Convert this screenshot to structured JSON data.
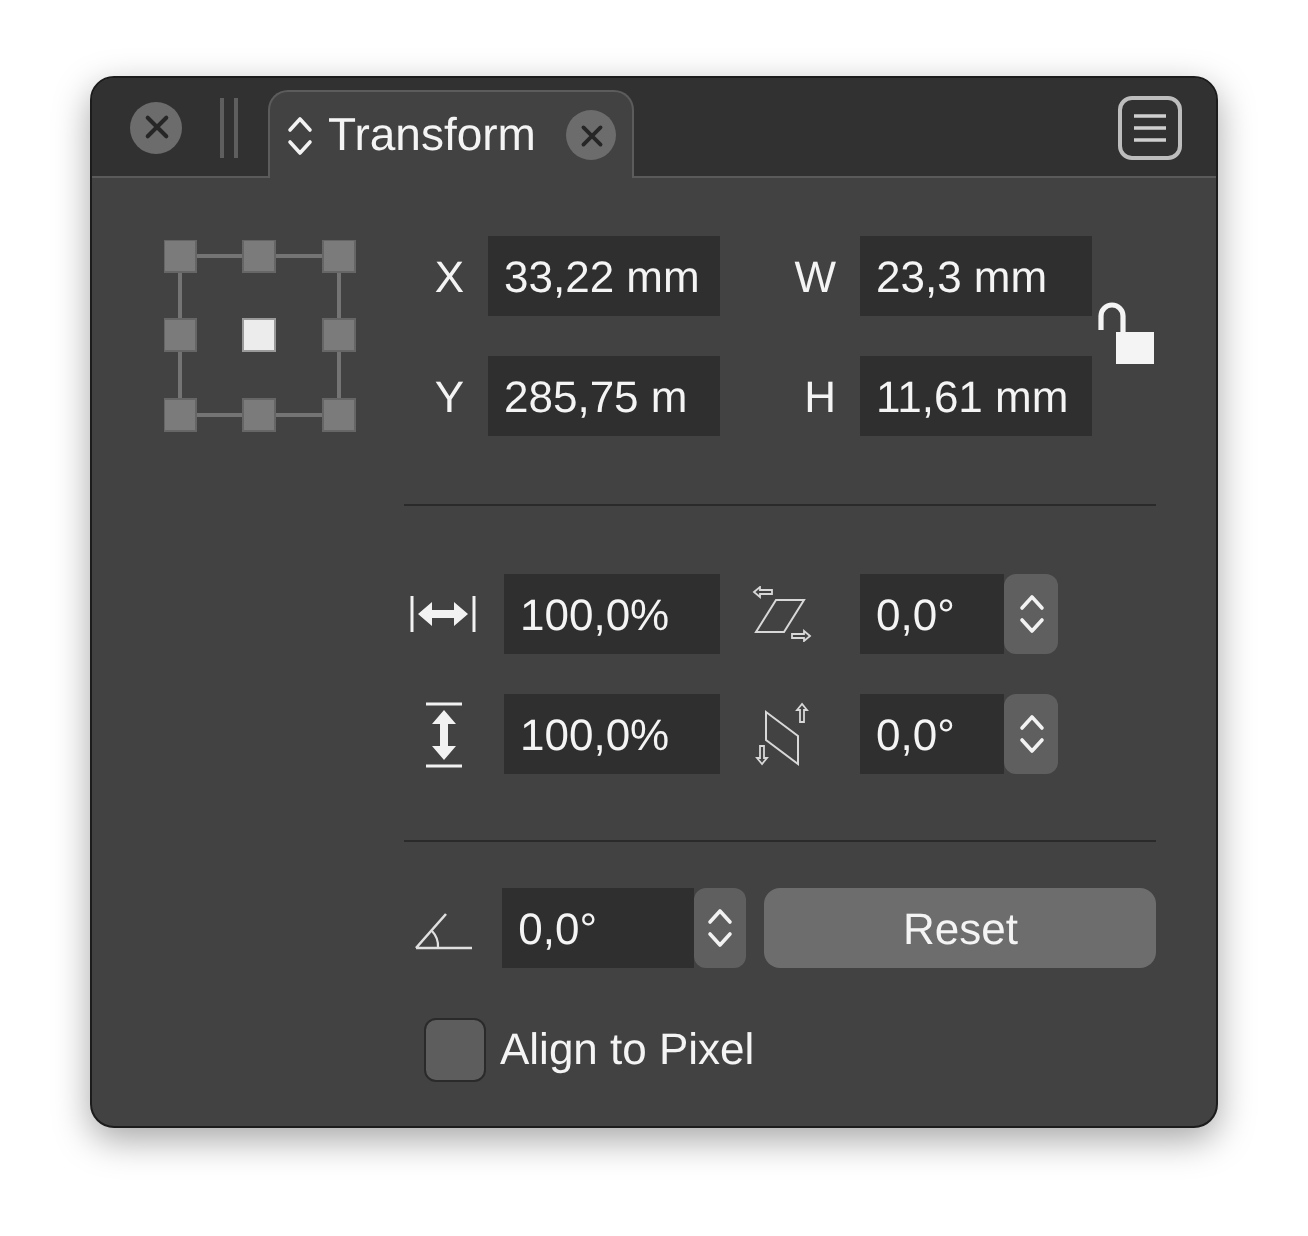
{
  "panel": {
    "tabs": [
      {
        "label": "Transform",
        "selected": true
      }
    ]
  },
  "anchor_points": [
    {
      "selected": false
    },
    {
      "selected": false
    },
    {
      "selected": false
    },
    {
      "selected": false
    },
    {
      "selected": true
    },
    {
      "selected": false
    },
    {
      "selected": false
    },
    {
      "selected": false
    },
    {
      "selected": false
    }
  ],
  "position_fields": [
    {
      "label": "X",
      "value": "33,22 mm"
    },
    {
      "label": "W",
      "value": "23,3 mm"
    },
    {
      "label": "Y",
      "value": "285,75 m"
    },
    {
      "label": "H",
      "value": "11,61 mm"
    }
  ],
  "aspect_lock": {
    "locked": false
  },
  "scale_fields": [
    {
      "kind": "width",
      "value": "100,0%"
    },
    {
      "kind": "height",
      "value": "100,0%"
    }
  ],
  "shear_fields": [
    {
      "kind": "horizontal",
      "value": "0,0°"
    },
    {
      "kind": "vertical",
      "value": "0,0°"
    }
  ],
  "rotation": {
    "value": "0,0°"
  },
  "reset_button": {
    "label": "Reset"
  },
  "align_to_pixels": {
    "label": "Align to Pixel",
    "checked": false
  }
}
